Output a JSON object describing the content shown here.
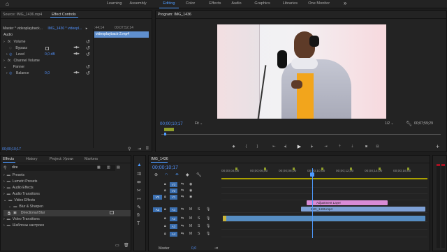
{
  "topbar": {
    "workspaces": [
      "Learning",
      "Assembly",
      "Editing",
      "Color",
      "Effects",
      "Audio",
      "Graphics",
      "Libraries",
      "One Monitor"
    ],
    "active": "Editing",
    "home": "⌂",
    "more": "»"
  },
  "source_panel": {
    "tab_source": "Source: IMG_1436.mp4",
    "tab_effect_controls": "Effect Controls",
    "master_label": "Master * videoplayback...",
    "sequence_label": "IMG_1436 * videopl...",
    "ruler_time1": ":44;14",
    "ruler_time2": "00;07;52;14",
    "clip_name": "videoplayback-2.mp4",
    "section_audio": "Audio",
    "volume": "Volume",
    "bypass": "Bypass",
    "level": "Level",
    "level_value": "0,0 dB",
    "channel_volume": "Channel Volume",
    "panner": "Panner",
    "balance": "Balance",
    "balance_value": "0,0",
    "timecode": "00;00;10;17"
  },
  "program_panel": {
    "title": "Program: IMG_1436",
    "timecode": "00;00;10;17",
    "fit": "Fit",
    "resolution": "1/2",
    "duration": "00;07;59;29"
  },
  "effects_panel": {
    "tabs": [
      "Effects",
      "History",
      "Project: Уроки",
      "Markers"
    ],
    "search": "dire",
    "tree": [
      {
        "label": "Presets",
        "level": 0
      },
      {
        "label": "Lumetri Presets",
        "level": 0
      },
      {
        "label": "Audio Effects",
        "level": 0
      },
      {
        "label": "Audio Transitions",
        "level": 0
      },
      {
        "label": "Video Effects",
        "level": 0
      },
      {
        "label": "Blur & Sharpen",
        "level": 1
      },
      {
        "label": "Directional Blur",
        "level": 2
      },
      {
        "label": "Video Transitions",
        "level": 0
      },
      {
        "label": "Шаблоны настроек",
        "level": 0
      }
    ]
  },
  "timeline": {
    "tab": "IMG_1436",
    "timecode": "00;00;10;17",
    "ruler": [
      "00;00;04;00",
      "00;00;06;00",
      "00;00;08;00",
      "00;00;10;00",
      "00;00;12;00",
      "00;00;14;00",
      "00;00;16;00"
    ],
    "video_tracks": [
      "V3",
      "V2",
      "V1"
    ],
    "audio_tracks": [
      "A1",
      "A2",
      "A3",
      "A4"
    ],
    "source_patch_v": "V1",
    "source_patch_a": "A1",
    "master": "Master",
    "master_value": "0,0",
    "clips": {
      "adjustment": "Adjustment Layer",
      "video": "IMG_1436.mp4"
    },
    "playhead_progress": 0.44
  },
  "colors": {
    "accent": "#4e9bff",
    "video_clip": "#7ea1d6",
    "adjustment_clip": "#d98bd6",
    "audio_clip": "#3f7bb4",
    "timecode": "#4f8ef7"
  }
}
